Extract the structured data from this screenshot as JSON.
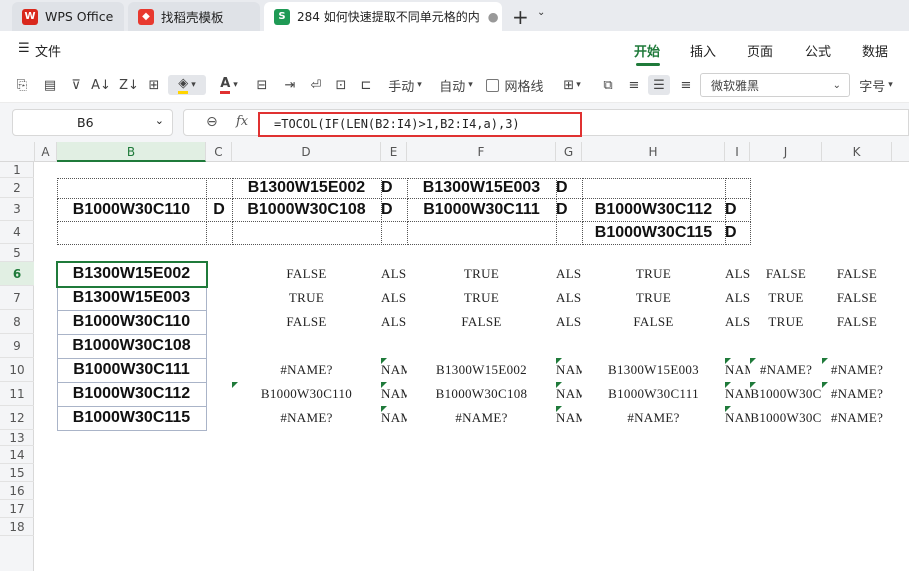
{
  "tabs": [
    {
      "label": "WPS Office",
      "icon": "wps-logo-icon"
    },
    {
      "label": "找稻壳模板",
      "icon": "docer-icon"
    },
    {
      "label": "284 如何快速提取不同单元格的内",
      "icon": "spreadsheet-s-icon",
      "icon_glyph": "S"
    }
  ],
  "menu": {
    "file": "文件",
    "items": [
      "开始",
      "插入",
      "页面",
      "公式",
      "数据"
    ],
    "active": "开始"
  },
  "toolbar": {
    "wrap_label": "手动",
    "auto_label": "自动",
    "gridlines_label": "网格线",
    "font_name": "微软雅黑",
    "font_size_label": "字号"
  },
  "formula_bar": {
    "name_box": "B6",
    "fx": "fx",
    "formula": "=TOCOL(IF(LEN(B2:I4)>1,B2:I4,a),3)"
  },
  "columns": [
    "A",
    "B",
    "C",
    "D",
    "E",
    "F",
    "G",
    "H",
    "I",
    "J",
    "K"
  ],
  "selected_column": "B",
  "rows": [
    "1",
    "2",
    "3",
    "4",
    "5",
    "6",
    "7",
    "8",
    "9",
    "10",
    "11",
    "12",
    "13",
    "14",
    "15",
    "16",
    "17",
    "18"
  ],
  "selected_row": "6",
  "cells": {
    "D2": "B1300W15E002",
    "E2": "D",
    "F2": "B1300W15E003",
    "G2": "D",
    "B3": "B1000W30C110",
    "C3": "D",
    "D3": "B1000W30C108",
    "E3": "D",
    "F3": "B1000W30C111",
    "G3": "D",
    "H3": "B1000W30C112",
    "I3": "D",
    "H4": "B1000W30C115",
    "I4": "D",
    "B6": "B1300W15E002",
    "B7": "B1300W15E003",
    "B8": "B1000W30C110",
    "B9": "B1000W30C108",
    "B10": "B1000W30C111",
    "B11": "B1000W30C112",
    "B12": "B1000W30C115",
    "D6": "FALSE",
    "E6": "ALS",
    "F6": "TRUE",
    "G6": "ALS",
    "H6": "TRUE",
    "I6": "ALS",
    "J6": "FALSE",
    "K6": "FALSE",
    "D7": "TRUE",
    "E7": "ALS",
    "F7": "TRUE",
    "G7": "ALS",
    "H7": "TRUE",
    "I7": "ALS",
    "J7": "TRUE",
    "K7": "FALSE",
    "D8": "FALSE",
    "E8": "ALS",
    "F8": "FALSE",
    "G8": "ALS",
    "H8": "FALSE",
    "I8": "ALS",
    "J8": "TRUE",
    "K8": "FALSE",
    "D10": "#NAME?",
    "E10": "NAME",
    "F10": "B1300W15E002",
    "G10": "NAME",
    "H10": "B1300W15E003",
    "I10": "NAME",
    "J10": "#NAME?",
    "K10": "#NAME?",
    "D11": "B1000W30C110",
    "E11": "NAME",
    "F11": "B1000W30C108",
    "G11": "NAME",
    "H11": "B1000W30C111",
    "I11": "NAME",
    "J11": "B1000W30C",
    "K11": "#NAME?",
    "D12": "#NAME?",
    "E12": "NAME",
    "F12": "#NAME?",
    "G12": "NAME",
    "H12": "#NAME?",
    "I12": "NAME",
    "J12": "B1000W30C",
    "K12": "#NAME?"
  },
  "colors": {
    "accent": "#1f7a3a",
    "highlight_border": "#e03131",
    "wps_red": "#d9281c"
  }
}
